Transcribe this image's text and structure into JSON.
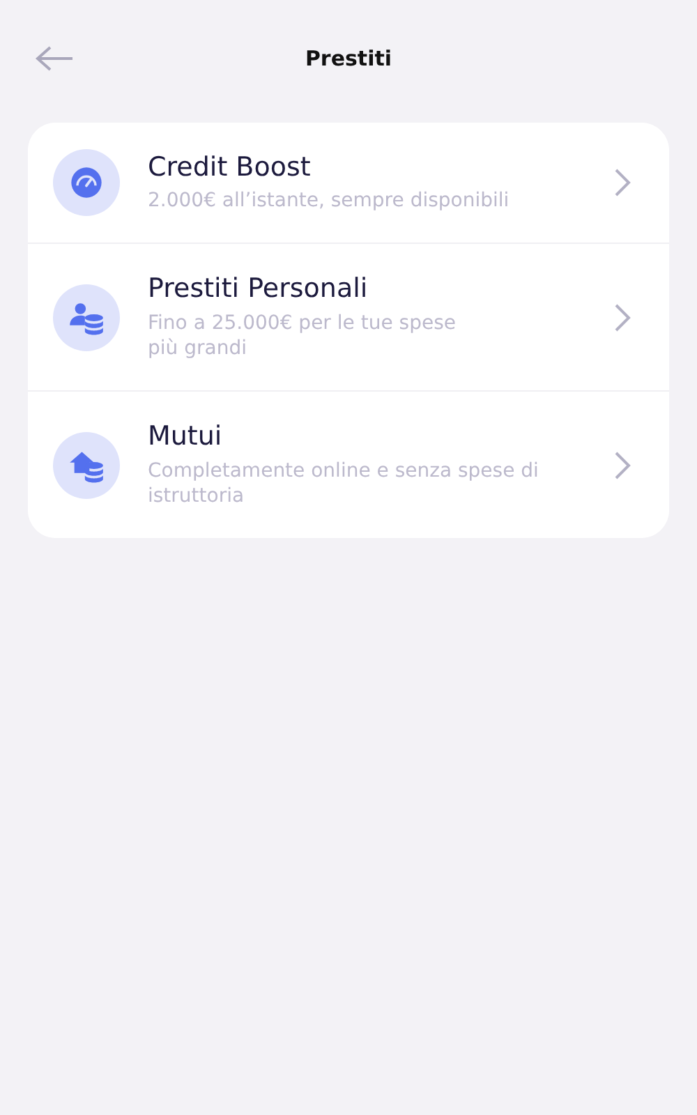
{
  "header": {
    "title": "Prestiti"
  },
  "items": [
    {
      "kind": "gauge",
      "title": "Credit Boost",
      "subtitle": "2.000€ all’istante, sempre disponibili"
    },
    {
      "kind": "person-coins",
      "title": "Prestiti Personali",
      "subtitle": "Fino a 25.000€ per le tue spese\npiù grandi"
    },
    {
      "kind": "house-coins",
      "title": "Mutui",
      "subtitle": "Completamente online e senza spese di istruttoria"
    }
  ]
}
